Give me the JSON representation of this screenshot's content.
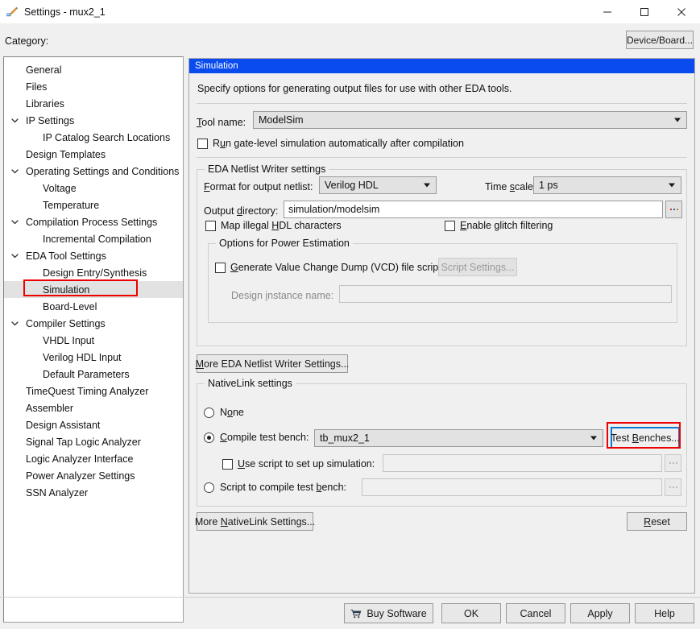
{
  "window": {
    "title": "Settings - mux2_1",
    "icon": "pencil-icon",
    "minimize": "minimize-icon",
    "maximize": "maximize-icon",
    "close": "close-icon"
  },
  "category": {
    "label": "Category:",
    "device_board_button": "Device/Board..."
  },
  "tree": {
    "items": [
      {
        "label": "General",
        "indent": 1,
        "chevron": false,
        "selected": false
      },
      {
        "label": "Files",
        "indent": 1,
        "chevron": false,
        "selected": false
      },
      {
        "label": "Libraries",
        "indent": 1,
        "chevron": false,
        "selected": false
      },
      {
        "label": "IP Settings",
        "indent": 1,
        "chevron": true,
        "selected": false
      },
      {
        "label": "IP Catalog Search Locations",
        "indent": 2,
        "chevron": false,
        "selected": false
      },
      {
        "label": "Design Templates",
        "indent": 1,
        "chevron": false,
        "selected": false
      },
      {
        "label": "Operating Settings and Conditions",
        "indent": 1,
        "chevron": true,
        "selected": false
      },
      {
        "label": "Voltage",
        "indent": 2,
        "chevron": false,
        "selected": false
      },
      {
        "label": "Temperature",
        "indent": 2,
        "chevron": false,
        "selected": false
      },
      {
        "label": "Compilation Process Settings",
        "indent": 1,
        "chevron": true,
        "selected": false
      },
      {
        "label": "Incremental Compilation",
        "indent": 2,
        "chevron": false,
        "selected": false
      },
      {
        "label": "EDA Tool Settings",
        "indent": 1,
        "chevron": true,
        "selected": false
      },
      {
        "label": "Design Entry/Synthesis",
        "indent": 2,
        "chevron": false,
        "selected": false
      },
      {
        "label": "Simulation",
        "indent": 2,
        "chevron": false,
        "selected": true
      },
      {
        "label": "Board-Level",
        "indent": 2,
        "chevron": false,
        "selected": false
      },
      {
        "label": "Compiler Settings",
        "indent": 1,
        "chevron": true,
        "selected": false
      },
      {
        "label": "VHDL Input",
        "indent": 2,
        "chevron": false,
        "selected": false
      },
      {
        "label": "Verilog HDL Input",
        "indent": 2,
        "chevron": false,
        "selected": false
      },
      {
        "label": "Default Parameters",
        "indent": 2,
        "chevron": false,
        "selected": false
      },
      {
        "label": "TimeQuest Timing Analyzer",
        "indent": 1,
        "chevron": false,
        "selected": false
      },
      {
        "label": "Assembler",
        "indent": 1,
        "chevron": false,
        "selected": false
      },
      {
        "label": "Design Assistant",
        "indent": 1,
        "chevron": false,
        "selected": false
      },
      {
        "label": "Signal Tap Logic Analyzer",
        "indent": 1,
        "chevron": false,
        "selected": false
      },
      {
        "label": "Logic Analyzer Interface",
        "indent": 1,
        "chevron": false,
        "selected": false
      },
      {
        "label": "Power Analyzer Settings",
        "indent": 1,
        "chevron": false,
        "selected": false
      },
      {
        "label": "SSN Analyzer",
        "indent": 1,
        "chevron": false,
        "selected": false
      }
    ]
  },
  "panel": {
    "header": "Simulation",
    "description": "Specify options for generating output files for use with other EDA tools.",
    "tool_name_label": "Tool name:",
    "tool_name_value": "ModelSim",
    "run_gatelevel_label": "Run gate-level simulation automatically after compilation",
    "run_gatelevel_checked": false
  },
  "netlist_group": {
    "title": "EDA Netlist Writer settings",
    "format_label": "Format for output netlist:",
    "format_value": "Verilog HDL",
    "timescale_label": "Time scale:",
    "timescale_value": "1 ps",
    "output_dir_label": "Output directory:",
    "output_dir_value": "simulation/modelsim",
    "browse_icon": "browse-ellipsis-icon",
    "map_illegal_label": "Map illegal HDL characters",
    "map_illegal_checked": false,
    "glitch_label": "Enable glitch filtering",
    "glitch_checked": false,
    "power_group": {
      "title": "Options for Power Estimation",
      "vcd_label": "Generate Value Change Dump (VCD) file script",
      "vcd_checked": false,
      "script_settings_button": "Script Settings...",
      "design_instance_label": "Design instance name:",
      "design_instance_value": ""
    },
    "more_button": "More EDA Netlist Writer Settings..."
  },
  "nativelink_group": {
    "title": "NativeLink settings",
    "none_label": "None",
    "compile_tb_label": "Compile test bench:",
    "compile_tb_value": "tb_mux2_1",
    "test_benches_button": "Test Benches...",
    "use_script_label": "Use script to set up simulation:",
    "use_script_value": "",
    "use_script_checked": false,
    "script_compile_label": "Script to compile test bench:",
    "script_compile_value": "",
    "selected_option": "compile_test_bench",
    "more_button": "More NativeLink Settings...",
    "reset_button": "Reset"
  },
  "footer": {
    "buy_software": "Buy Software",
    "buy_icon": "shopping-cart-icon",
    "ok": "OK",
    "cancel": "Cancel",
    "apply": "Apply",
    "help": "Help"
  },
  "annotations": {
    "highlight_color": "#ee0000",
    "focus_color": "#0a78d4",
    "header_color": "#0a4bf0"
  }
}
